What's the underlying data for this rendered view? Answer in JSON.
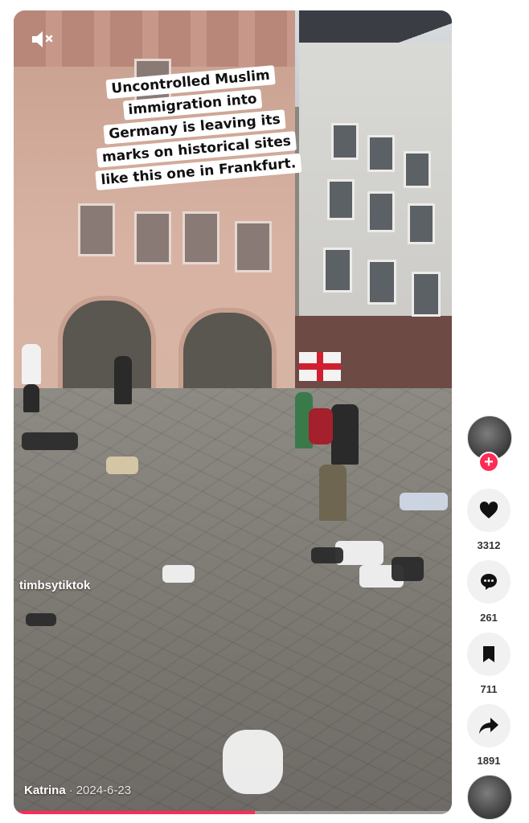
{
  "video": {
    "caption_lines": [
      "Uncontrolled Muslim",
      "immigration into",
      "Germany is leaving its",
      "marks on historical sites",
      "like this one in Frankfurt."
    ],
    "watermark": "timbsytiktok",
    "author": "Katrina",
    "separator": "·",
    "date": "2024-6-23",
    "progress": 0.55,
    "mute_icon": "speaker-muted-icon"
  },
  "actions": {
    "avatar_icon": "profile-avatar",
    "follow_symbol": "+",
    "likes": "3312",
    "comments": "261",
    "saves": "711",
    "shares": "1891"
  },
  "colors": {
    "accent": "#fe2c55",
    "button_bg": "#f1f1f2",
    "count_text": "#333333"
  }
}
